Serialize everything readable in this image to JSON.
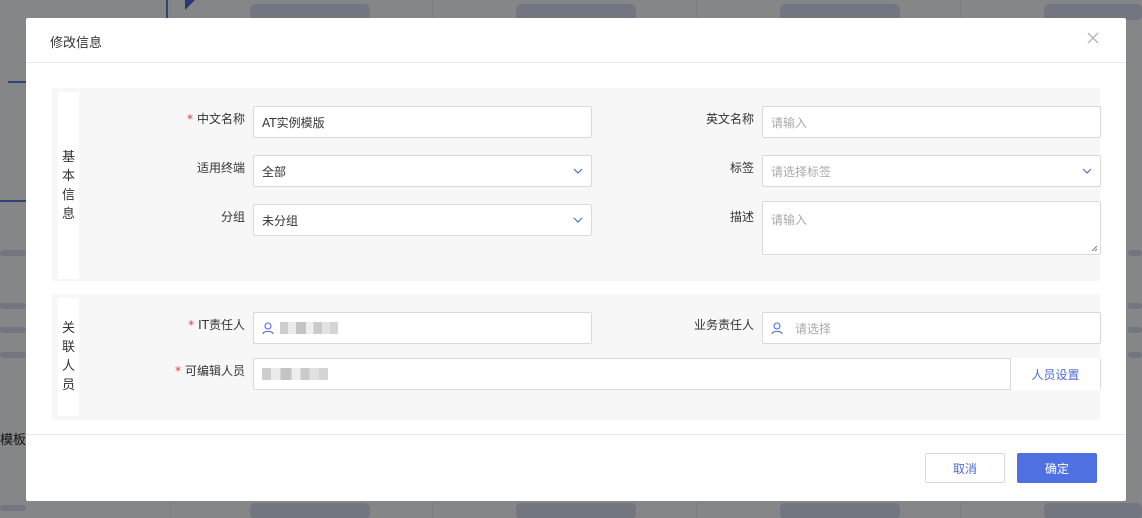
{
  "background": {
    "label": "模板"
  },
  "dialog": {
    "title": "修改信息",
    "close_icon": "close-icon",
    "sections": {
      "basic": {
        "tag": [
          "基",
          "本",
          "信",
          "息"
        ]
      },
      "people": {
        "tag": [
          "关",
          "联",
          "人",
          "员"
        ]
      }
    },
    "fields": {
      "cn_name": {
        "label": "中文名称",
        "required": "*",
        "value": "AT实例模版"
      },
      "en_name": {
        "label": "英文名称",
        "placeholder": "请输入"
      },
      "terminal": {
        "label": "适用终端",
        "value": "全部"
      },
      "tags": {
        "label": "标签",
        "placeholder": "请选择标签"
      },
      "group": {
        "label": "分组",
        "value": "未分组"
      },
      "desc": {
        "label": "描述",
        "placeholder": "请输入"
      },
      "it_owner": {
        "label": "IT责任人",
        "required": "*"
      },
      "biz_owner": {
        "label": "业务责任人",
        "placeholder": "请选择"
      },
      "editors": {
        "label": "可编辑人员",
        "required": "*",
        "addon": "人员设置"
      }
    },
    "footer": {
      "cancel": "取消",
      "ok": "确定"
    }
  },
  "colors": {
    "primary": "#4f70e0",
    "required": "#e4393c",
    "link": "#4d6bd8"
  }
}
